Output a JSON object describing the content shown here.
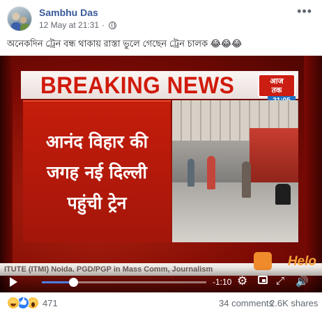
{
  "post": {
    "author": "Sambhu Das",
    "timestamp": "12 May at 21:31",
    "privacy_icon": "globe-icon",
    "more_icon": "more-options-icon",
    "caption": "অনেকদিন ট্রেন বন্ধ থাকায় রাস্তা ভুলে গেছেন ট্রেন চালক 😂😂😂"
  },
  "video": {
    "breaking_text": "BREAKING NEWS",
    "logo_text_1": "आज",
    "logo_text_2": "तक",
    "logo_time": "21:05",
    "hindi_lines": [
      "आनंद विहार की",
      "जगह नई दिल्ली",
      "पहुंची ट्रेन"
    ],
    "ticker": "ITUTE (ITMI) Noida. PGD/PGP in Mass Comm, Journalism",
    "watermark": "Helo",
    "time_remaining": "-1:10",
    "progress": 0.19
  },
  "footer": {
    "reaction_count": "471",
    "comments": "34 comments",
    "shares": "2.6K shares"
  },
  "colors": {
    "author_link": "#385898",
    "breaking_red": "#d01a0c",
    "progress_blue": "#4b7fe0"
  }
}
